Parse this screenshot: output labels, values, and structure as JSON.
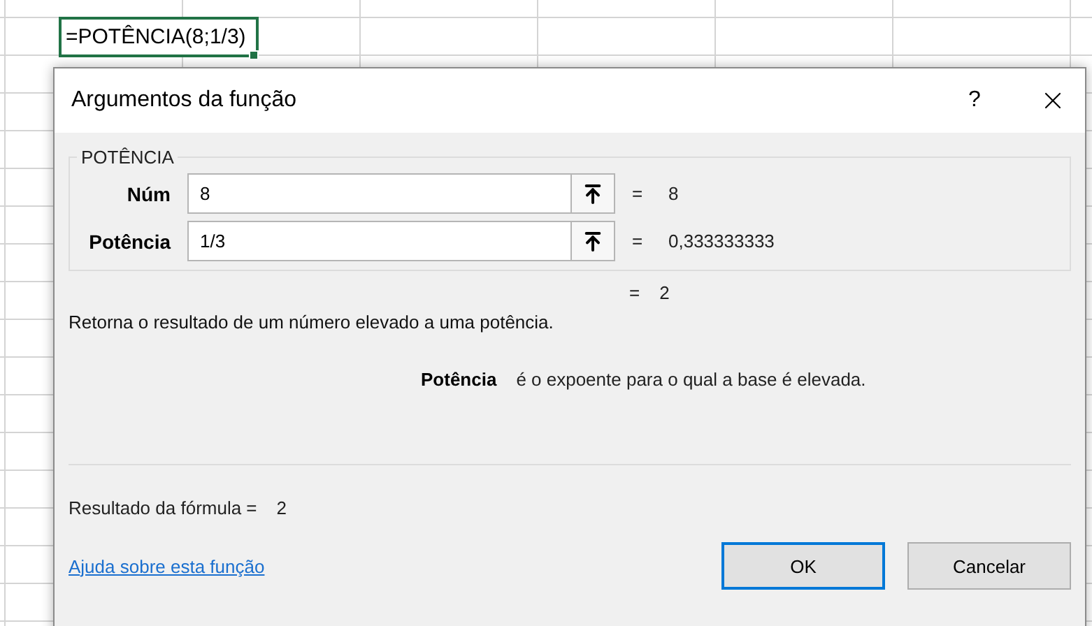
{
  "sheet": {
    "formula": "=POTÊNCIA(8;1/3)"
  },
  "dialog": {
    "title": "Argumentos da função",
    "help": "?",
    "group_label": "POTÊNCIA",
    "arguments": [
      {
        "label": "Núm",
        "value": "8",
        "equals": "=",
        "result": "8"
      },
      {
        "label": "Potência",
        "value": "1/3",
        "equals": "=",
        "result": "0,333333333"
      }
    ],
    "total": {
      "equals": "=",
      "value": "2"
    },
    "description": "Retorna o resultado de um número elevado a uma potência.",
    "argument_help": {
      "name": "Potência",
      "text": "é o expoente para o qual a base é elevada."
    },
    "formula_result": {
      "label": "Resultado da fórmula =",
      "value": "2"
    },
    "help_link": "Ajuda sobre esta função",
    "buttons": [
      {
        "label": "OK",
        "default": true
      },
      {
        "label": "Cancelar",
        "default": false
      }
    ]
  }
}
